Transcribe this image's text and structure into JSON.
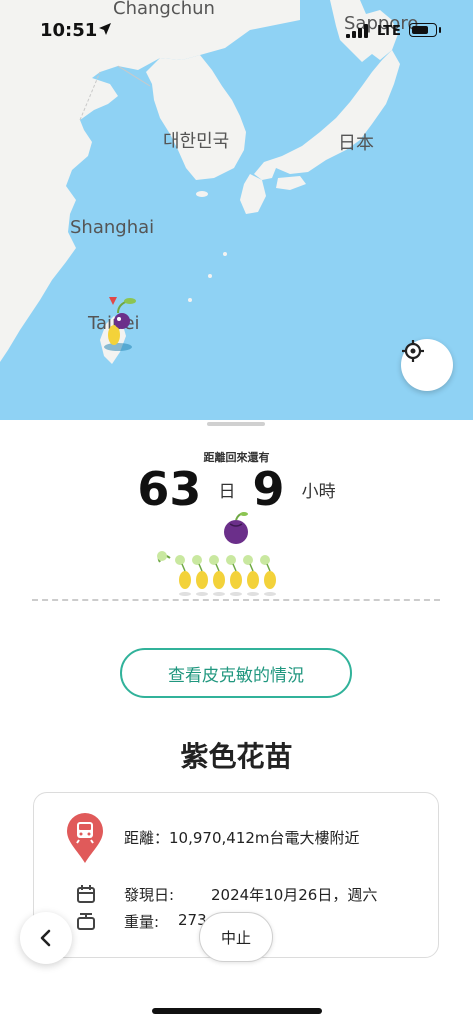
{
  "status_bar": {
    "time": "10:51",
    "network": "LTE",
    "battery_percent": 85
  },
  "map": {
    "labels": {
      "changchun": "Changchun",
      "sapporo": "Sapporo",
      "korea": "대한민국",
      "japan": "日本",
      "shanghai": "Shanghai",
      "taipei": "Taipei"
    },
    "colors": {
      "sea": "#8fd2f4",
      "land": "#f3f3f1"
    }
  },
  "trip": {
    "caption": "距離回來還有",
    "days": "63",
    "days_unit": "日",
    "hours": "9",
    "hours_unit": "小時"
  },
  "view_button": "查看皮克敏的情況",
  "item_title": "紫色花苗",
  "details": {
    "distance_label": "距離：",
    "distance_value": "10,970,412m",
    "distance_place": "台電大樓附近",
    "found_label": "發現日:",
    "found_value": "2024年10月26日，週六",
    "weight_label": "重量:",
    "weight_value": "273"
  },
  "stop_button": "中止",
  "colors": {
    "accent": "#31b29a",
    "pin": "#e05a5a"
  }
}
